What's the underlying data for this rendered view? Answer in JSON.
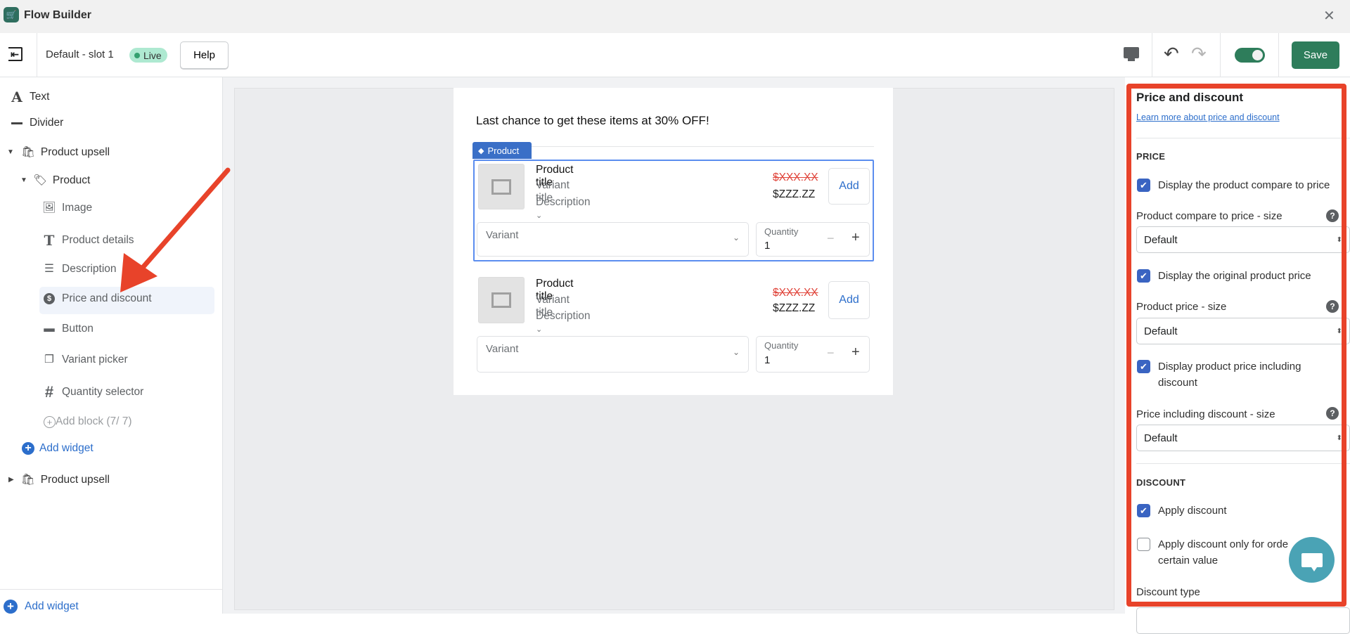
{
  "app": {
    "title": "Flow Builder"
  },
  "toolbar": {
    "slot_name": "Default - slot 1",
    "status": "Live",
    "help": "Help",
    "save": "Save",
    "toggle_on": true
  },
  "sidebar": {
    "items": [
      {
        "label": "Text",
        "icon": "text-icon"
      },
      {
        "label": "Divider",
        "icon": "divider-icon"
      },
      {
        "label": "Product upsell",
        "icon": "shopping-bag-icon",
        "expanded": true
      },
      {
        "label": "Product",
        "icon": "tag-icon",
        "expanded": true
      },
      {
        "label": "Image",
        "icon": "image-icon"
      },
      {
        "label": "Product details",
        "icon": "text-t-icon"
      },
      {
        "label": "Description",
        "icon": "list-icon"
      },
      {
        "label": "Price and discount",
        "icon": "dollar-icon",
        "selected": true
      },
      {
        "label": "Button",
        "icon": "button-cursor-icon"
      },
      {
        "label": "Variant picker",
        "icon": "variant-icon"
      },
      {
        "label": "Quantity selector",
        "icon": "hash-icon"
      },
      {
        "label": "Add block (7/ 7)",
        "icon": "plus-circle-icon"
      },
      {
        "label": "Add widget",
        "icon": "plus-circle-filled-icon"
      },
      {
        "label": "Product upsell",
        "icon": "shopping-bag-icon",
        "expanded": false
      }
    ],
    "footer_add_widget": "Add widget"
  },
  "preview": {
    "heading": "Last chance to get these items at 30% OFF!",
    "tag_label": "Product",
    "products": [
      {
        "title": "Product title",
        "variant": "Variant title",
        "description": "Description",
        "compare_price": "$XXX.XX",
        "price": "$ZZZ.ZZ",
        "add": "Add",
        "variant_placeholder": "Variant",
        "quantity_label": "Quantity",
        "quantity": "1"
      },
      {
        "title": "Product title",
        "variant": "Variant title",
        "description": "Description",
        "compare_price": "$XXX.XX",
        "price": "$ZZZ.ZZ",
        "add": "Add",
        "variant_placeholder": "Variant",
        "quantity_label": "Quantity",
        "quantity": "1"
      }
    ]
  },
  "panel": {
    "title": "Price and discount",
    "link": "Learn more about price and discount",
    "price_section": "PRICE",
    "cb_compare": "Display the product compare to price",
    "compare_size_label": "Product compare to price - size",
    "compare_size": "Default",
    "cb_original": "Display the original product price",
    "price_size_label": "Product price - size",
    "price_size": "Default",
    "cb_including_1": "Display product price including",
    "cb_including_2": "discount",
    "including_size_label": "Price including discount - size",
    "including_size": "Default",
    "discount_section": "DISCOUNT",
    "cb_apply": "Apply discount",
    "cb_apply_only_1": "Apply discount only for orde",
    "cb_apply_only_2": "certain value",
    "discount_type_label": "Discount type"
  },
  "colors": {
    "accent": "#3a64c2",
    "save": "#2e7d5b",
    "annotation": "#e8432a",
    "chat": "#4aa3b5"
  }
}
